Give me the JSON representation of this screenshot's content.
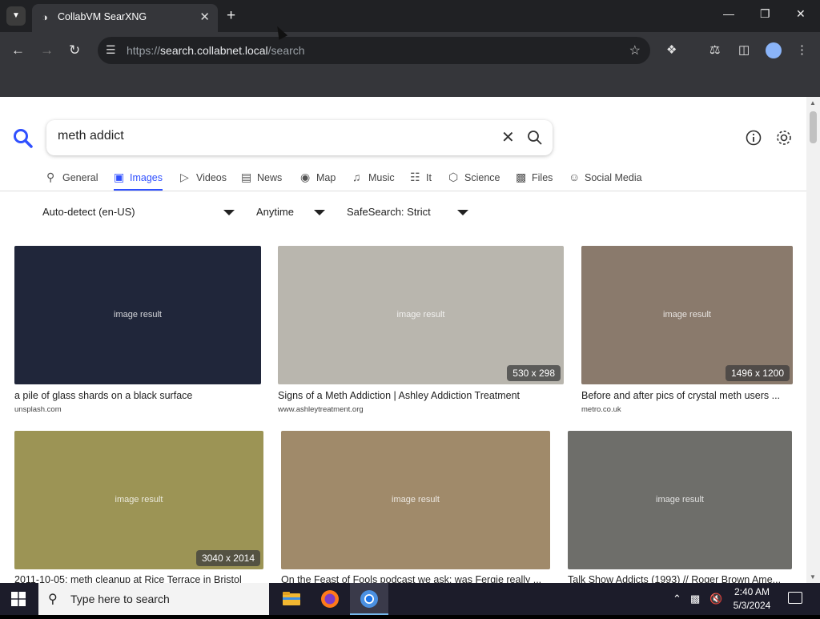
{
  "browser": {
    "tab_title": "CollabVM SearXNG",
    "url_scheme": "https://",
    "url_host": "search.collabnet.local",
    "url_path": "/search",
    "icons": [
      "tab-search-icon",
      "favicon-icon",
      "close-icon",
      "new-tab-icon",
      "minimize-icon",
      "maximize-icon",
      "window-close-icon",
      "back-icon",
      "forward-icon",
      "reload-icon",
      "site-settings-icon",
      "bookmark-star-icon",
      "extensions-icon",
      "labs-icon",
      "side-panel-icon",
      "profile-icon",
      "menu-icon"
    ]
  },
  "search": {
    "query": "meth addict",
    "categories": [
      {
        "label": "General",
        "icon": "search-icon"
      },
      {
        "label": "Images",
        "icon": "image-icon",
        "active": true
      },
      {
        "label": "Videos",
        "icon": "play-icon"
      },
      {
        "label": "News",
        "icon": "newspaper-icon"
      },
      {
        "label": "Map",
        "icon": "map-pin-icon"
      },
      {
        "label": "Music",
        "icon": "music-icon"
      },
      {
        "label": "It",
        "icon": "layers-icon"
      },
      {
        "label": "Science",
        "icon": "science-icon"
      },
      {
        "label": "Files",
        "icon": "files-icon"
      },
      {
        "label": "Social Media",
        "icon": "people-icon"
      }
    ],
    "filters": {
      "language": "Auto-detect (en-US)",
      "time": "Anytime",
      "safesearch": "SafeSearch: Strict"
    }
  },
  "results": [
    {
      "title": "a pile of glass shards on a black surface",
      "source": "unsplash.com",
      "dims": "",
      "placeholder": "image result",
      "color": "#20263a"
    },
    {
      "title": "Signs of a Meth Addiction | Ashley Addiction Treatment",
      "source": "www.ashleytreatment.org",
      "dims": "530 x 298",
      "placeholder": "image result",
      "color": "#b9b6ae"
    },
    {
      "title": "Before and after pics of crystal meth users ...",
      "source": "metro.co.uk",
      "dims": "1496 x 1200",
      "placeholder": "image result",
      "color": "#8a7a6c"
    },
    {
      "title": "2011-10-05: meth cleanup at Rice Terrace in Bristol",
      "source": "",
      "dims": "3040 x 2014",
      "placeholder": "image result",
      "color": "#9c9455"
    },
    {
      "title": "On the Feast of Fools podcast we ask: was Fergie really ...",
      "source": "",
      "dims": "",
      "placeholder": "image result",
      "color": "#a08a6a"
    },
    {
      "title": "Talk Show Addicts (1993) // Roger Brown Ame...",
      "source": "",
      "dims": "",
      "placeholder": "image result",
      "color": "#6e6e6a"
    }
  ],
  "taskbar": {
    "search_placeholder": "Type here to search",
    "time": "2:40 AM",
    "date": "5/3/2024",
    "icons": [
      "windows-start-icon",
      "file-explorer-icon",
      "firefox-icon",
      "chrome-icon",
      "chevron-up-icon",
      "network-icon",
      "volume-muted-icon",
      "notification-icon"
    ]
  }
}
